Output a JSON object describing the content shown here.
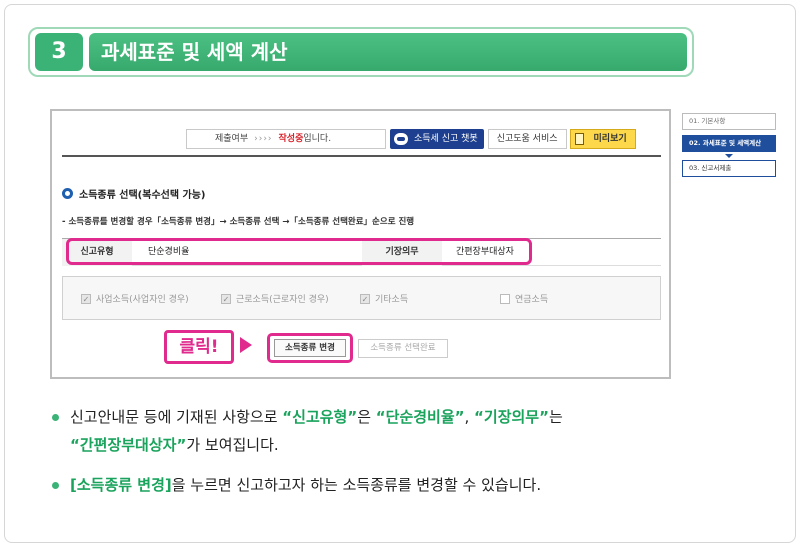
{
  "step": {
    "number": "3",
    "title": "과세표준 및 세액 계산"
  },
  "toolbar": {
    "submit_label": "제출여부",
    "arrows": "››››",
    "status_writing": "작성중",
    "status_suffix": "입니다.",
    "chatbot_label": "소득세 신고 챗봇",
    "help_label": "신고도움 서비스",
    "preview_label": "미리보기"
  },
  "section": {
    "title": "소득종류 선택(복수선택 가능)",
    "instruction": "- 소득종류를 변경할 경우「소득종류 변경」→ 소득종류 선택 →「소득종류 선택완료」순으로 진행"
  },
  "info_table": {
    "type_label": "신고유형",
    "type_value": "단순경비율",
    "bookkeeping_label": "기장의무",
    "bookkeeping_value": "간편장부대상자"
  },
  "income_types": [
    {
      "label": "사업소득(사업자인 경우)",
      "checked": true
    },
    {
      "label": "근로소득(근로자인 경우)",
      "checked": true
    },
    {
      "label": "기타소득",
      "checked": true
    },
    {
      "label": "연금소득",
      "checked": false
    }
  ],
  "actions": {
    "click_label": "클릭!",
    "change_label": "소득종류 변경",
    "complete_label": "소득종류 선택완료"
  },
  "side_nav": [
    {
      "label": "01. 기본사항"
    },
    {
      "label": "02. 과세표준 및 세액계산"
    },
    {
      "label": "03. 신고서제출"
    }
  ],
  "bullets": {
    "b1_a": "신고안내문 등에 기재된 사항으로 ",
    "b1_q1": "“신고유형”",
    "b1_b": "은 ",
    "b1_q2": "“단순경비율”",
    "b1_c": ", ",
    "b1_q3": "“기장의무”",
    "b1_d": "는 ",
    "b1_q4": "“간편장부대상자”",
    "b1_e": "가 보여집니다.",
    "b2_hl": "[소득종류 변경]",
    "b2_text": "을 누르면 신고하고자 하는 소득종류를 변경할 수 있습니다."
  },
  "colors": {
    "accent_green": "#3bb377",
    "highlight_pink": "#e02a8e",
    "nav_blue": "#1f4f9c"
  }
}
